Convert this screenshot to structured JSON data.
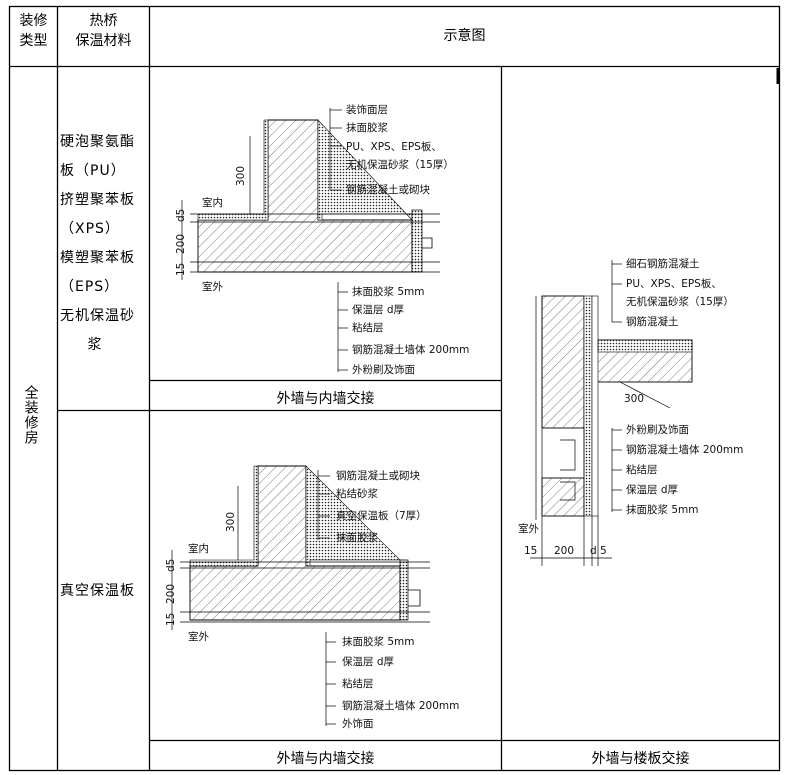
{
  "header": {
    "col1": [
      "装修",
      "类型"
    ],
    "col2": [
      "热桥",
      "保温材料"
    ],
    "col3": "示意图"
  },
  "row_type": "全装修房",
  "materials_top": [
    "硬泡聚氨酯",
    "板（PU）",
    "挤塑聚苯板",
    "（XPS）",
    "模塑聚苯板",
    "（EPS）",
    "无机保温砂",
    "浆"
  ],
  "materials_bottom": "真空保温板",
  "captions": {
    "top_left": "外墙与内墙交接",
    "bottom_left": "外墙与内墙交接",
    "right": "外墙与楼板交接"
  },
  "diagram_top": {
    "labels_upper": [
      "装饰面层",
      "抹面胶浆",
      "PU、XPS、EPS板、",
      "无机保温砂浆（15厚）",
      "钢筋混凝土或砌块"
    ],
    "labels_lower": [
      "抹面胶浆 5mm",
      "保温层 d厚",
      "粘结层",
      "钢筋混凝土墙体 200mm",
      "外粉刷及饰面"
    ],
    "dims": [
      "300",
      "d5",
      "200",
      "15"
    ],
    "indoor": "室内",
    "outdoor": "室外"
  },
  "diagram_bottom": {
    "labels_upper": [
      "钢筋混凝土或砌块",
      "粘结砂浆",
      "真空保温板（7厚）",
      "抹面胶浆"
    ],
    "labels_lower": [
      "抹面胶浆 5mm",
      "保温层 d厚",
      "粘结层",
      "钢筋混凝土墙体 200mm",
      "外饰面"
    ],
    "dims": [
      "300",
      "d5",
      "200",
      "15"
    ],
    "indoor": "室内",
    "outdoor": "室外"
  },
  "diagram_right": {
    "labels_upper": [
      "细石钢筋混凝土",
      "PU、XPS、EPS板、",
      "无机保温砂浆（15厚）",
      "钢筋混凝土"
    ],
    "labels_lower": [
      "外粉刷及饰面",
      "钢筋混凝土墙体 200mm",
      "粘结层",
      "保温层 d厚",
      "抹面胶浆 5mm"
    ],
    "dim_300": "300",
    "outdoor": "室外",
    "dims_bottom": [
      "15",
      "200",
      "d",
      "5"
    ]
  }
}
